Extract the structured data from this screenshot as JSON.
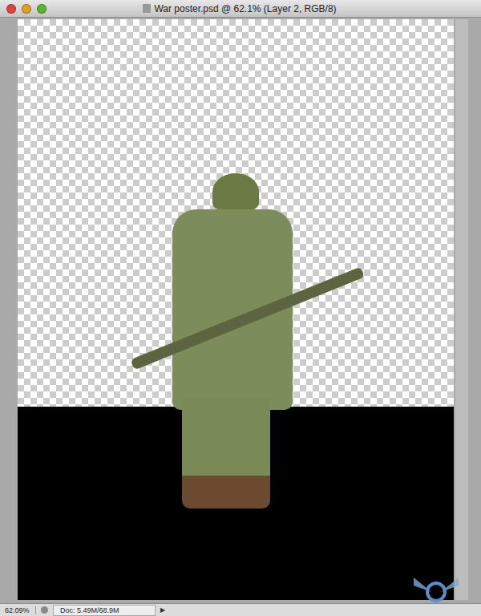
{
  "window": {
    "title": "War poster.psd @ 62.1% (Layer 2, RGB/8)"
  },
  "status_bar": {
    "zoom": "62.09%",
    "doc": "Doc: 5.49M/68.9M",
    "menu_arrow": "▶"
  }
}
